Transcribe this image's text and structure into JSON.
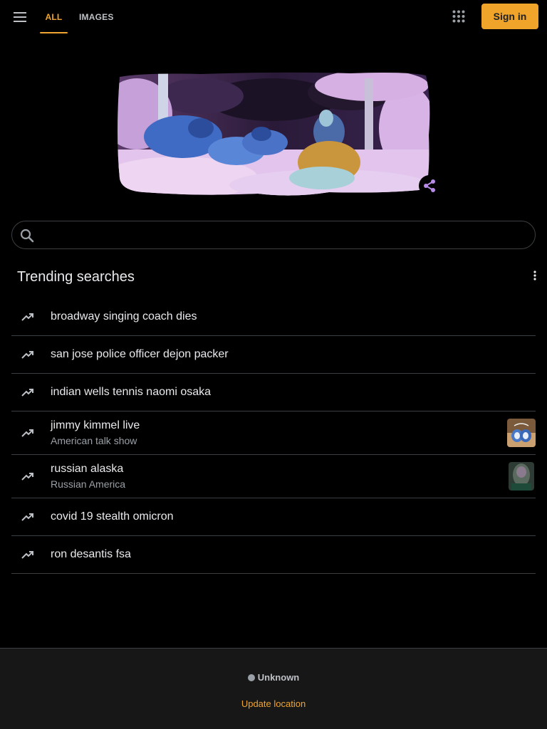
{
  "header": {
    "tabs": [
      {
        "label": "ALL",
        "active": true
      },
      {
        "label": "IMAGES",
        "active": false
      }
    ],
    "menu_icon": "hamburger-menu-icon",
    "apps_icon": "apps-grid-icon",
    "sign_in_label": "Sign in"
  },
  "doodle": {
    "share_icon": "share-icon"
  },
  "search": {
    "placeholder": "",
    "value": ""
  },
  "trending": {
    "title": "Trending searches",
    "more_icon": "more-vert-icon",
    "items": [
      {
        "query": "broadway singing coach dies"
      },
      {
        "query": "san jose police officer dejon packer"
      },
      {
        "query": "indian wells tennis naomi osaka"
      },
      {
        "query": "jimmy kimmel live",
        "subtitle": "American talk show"
      },
      {
        "query": "russian alaska",
        "subtitle": "Russian America"
      },
      {
        "query": "covid 19 stealth omicron"
      },
      {
        "query": "ron desantis fsa"
      }
    ]
  },
  "footer": {
    "location": "Unknown",
    "update_location": "Update location"
  },
  "colors": {
    "background": "#000000",
    "accent": "#f0a530",
    "sign_in_bg": "#f0a42a",
    "divider": "#3c4043",
    "footer_bg": "#171717",
    "share_icon": "#b98be8"
  }
}
